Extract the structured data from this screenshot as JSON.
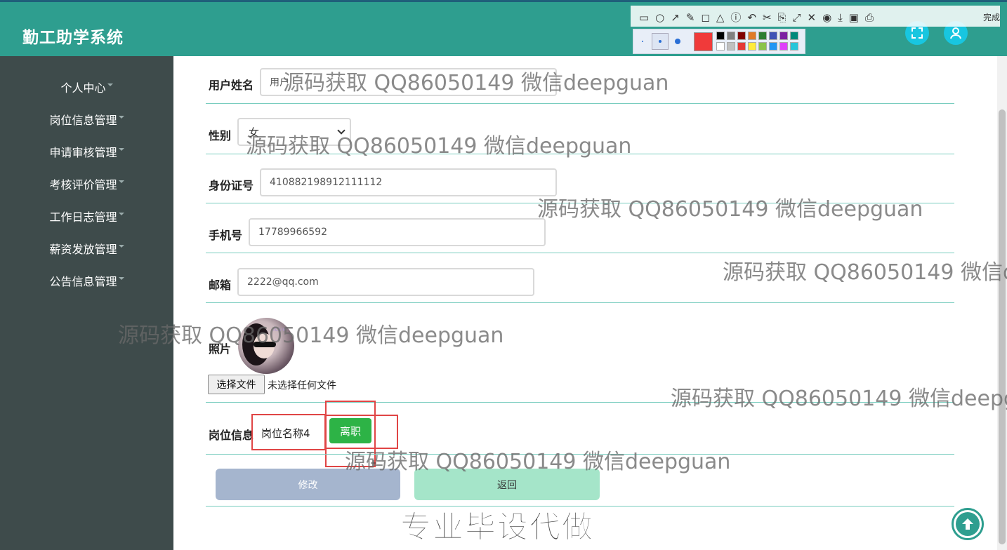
{
  "header": {
    "app_title": "勤工助学系统",
    "accent_color": "#2e9e8f"
  },
  "sidebar": {
    "items": [
      {
        "label": "个人中心"
      },
      {
        "label": "岗位信息管理"
      },
      {
        "label": "申请审核管理"
      },
      {
        "label": "考核评价管理"
      },
      {
        "label": "工作日志管理"
      },
      {
        "label": "薪资发放管理"
      },
      {
        "label": "公告信息管理"
      }
    ]
  },
  "form": {
    "username": {
      "label": "用户姓名",
      "value": "用户"
    },
    "gender": {
      "label": "性别",
      "value": "女"
    },
    "id_card": {
      "label": "身份证号",
      "value": "410882198912111112"
    },
    "phone": {
      "label": "手机号",
      "value": "17789966592"
    },
    "email": {
      "label": "邮箱",
      "value": "2222@qq.com"
    },
    "photo": {
      "label": "照片",
      "file_button": "选择文件",
      "file_status": "未选择任何文件"
    },
    "position": {
      "label": "岗位信息",
      "value": "岗位名称4",
      "leave_button": "离职"
    },
    "submit_button": "修改",
    "back_button": "返回"
  },
  "watermark": {
    "text": "源码获取 QQ86050149 微信deepguan",
    "text_cut_1": "源码获取 QQ86050149 微信d",
    "text_cut_2": "源码获取 QQ86050149 微信deepg",
    "slogan": "专业毕设代做"
  },
  "screenshot_toolbar": {
    "done_label": "完成",
    "current_color": "#f03a3a",
    "swatches": [
      "#000000",
      "#808080",
      "#800000",
      "#e07b28",
      "#2e7d32",
      "#3f51b5",
      "#7b1fa2",
      "#00897b",
      "#ffffff",
      "#c0c0c0",
      "#e53935",
      "#ffeb3b",
      "#8bc34a",
      "#2196f3",
      "#e040fb",
      "#26c6da"
    ]
  }
}
